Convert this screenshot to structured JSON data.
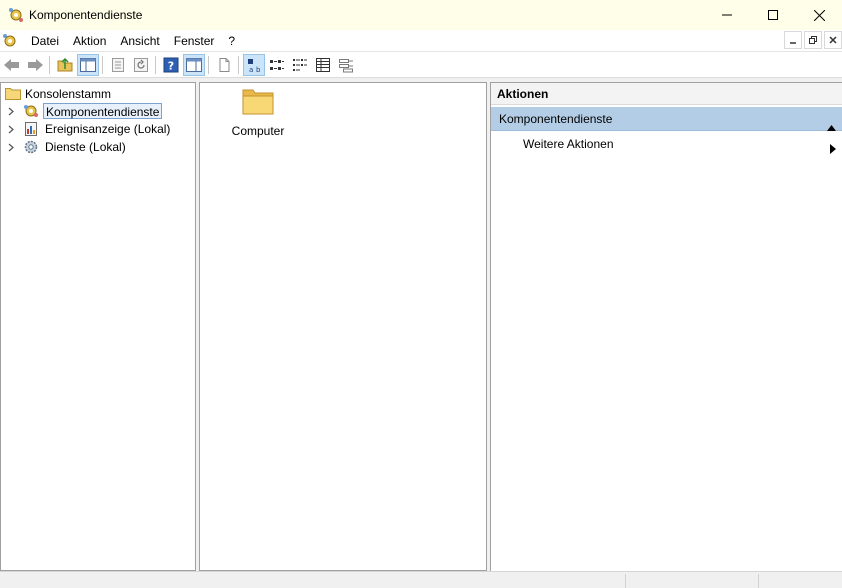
{
  "window": {
    "title": "Komponentendienste",
    "icon": "component-services-icon"
  },
  "menu": {
    "items": [
      "Datei",
      "Aktion",
      "Ansicht",
      "Fenster",
      "?"
    ]
  },
  "toolbar": {
    "buttons": [
      "back-icon",
      "forward-icon",
      "up-folder-icon",
      "show-hide-tree-icon",
      "properties-icon",
      "refresh-icon",
      "help-icon",
      "show-hide-action-pane-icon",
      "new-window-icon",
      "large-icons-view-icon",
      "small-icons-view-icon",
      "list-view-icon",
      "details-view-icon",
      "configure-view-icon"
    ]
  },
  "tree": {
    "root": "Konsolenstamm",
    "nodes": [
      {
        "label": "Komponentendienste",
        "icon": "component-services-icon",
        "selected": true
      },
      {
        "label": "Ereignisanzeige (Lokal)",
        "icon": "event-viewer-icon",
        "selected": false
      },
      {
        "label": "Dienste (Lokal)",
        "icon": "services-gear-icon",
        "selected": false
      }
    ]
  },
  "results": {
    "items": [
      {
        "label": "Computer",
        "icon": "folder-icon"
      }
    ]
  },
  "actions": {
    "header": "Aktionen",
    "section": "Komponentendienste",
    "items": [
      "Weitere Aktionen"
    ]
  },
  "colors": {
    "titlebar": "#fffee9",
    "action_section": "#b3cde6",
    "selection_border": "#7da2ce"
  }
}
